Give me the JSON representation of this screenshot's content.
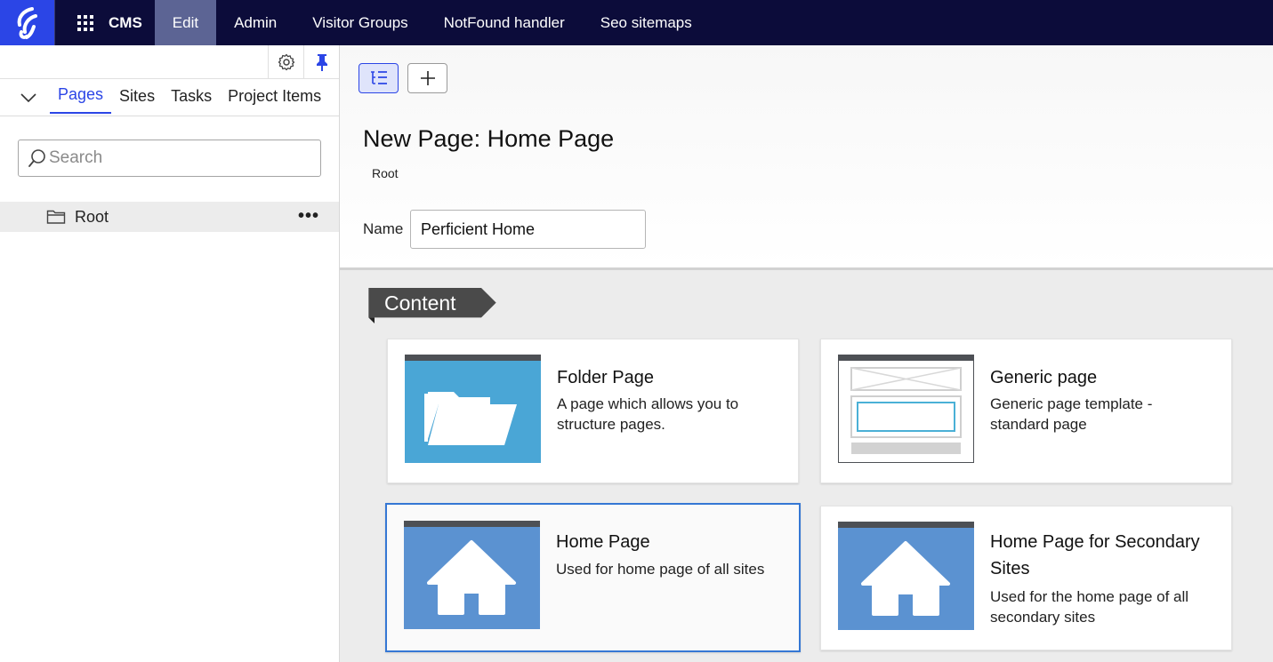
{
  "topnav": {
    "app_label": "CMS",
    "items": [
      "Edit",
      "Admin",
      "Visitor Groups",
      "NotFound handler",
      "Seo sitemaps"
    ],
    "active_index": 0
  },
  "left_panel": {
    "tabs": [
      "Pages",
      "Sites",
      "Tasks",
      "Project Items"
    ],
    "active_tab": "Pages",
    "search": {
      "placeholder": "Search",
      "value": ""
    },
    "tree": [
      {
        "label": "Root",
        "icon": "folder-icon"
      }
    ]
  },
  "header": {
    "title": "New Page: Home Page",
    "breadcrumb": "Root",
    "name_label": "Name",
    "name_value": "Perficient Home"
  },
  "content": {
    "section_label": "Content",
    "cards": [
      {
        "title": "Folder Page",
        "description": "A page which allows you to structure pages.",
        "icon": "folder-icon",
        "selected": false
      },
      {
        "title": "Generic page",
        "description": "Generic page template - standard page",
        "icon": "page-template-icon",
        "selected": false
      },
      {
        "title": "Home Page",
        "description": "Used for home page of all sites",
        "icon": "home-icon",
        "selected": true
      },
      {
        "title": "Home Page for Secondary Sites",
        "description": "Used for the home page of all secondary sites",
        "icon": "home-icon",
        "selected": false
      }
    ]
  },
  "colors": {
    "nav_bg": "#0c0c3a",
    "accent": "#2b45e6",
    "selected_border": "#3577d4",
    "folder_thumb": "#4aa6d6",
    "home_thumb": "#5b92d1"
  }
}
